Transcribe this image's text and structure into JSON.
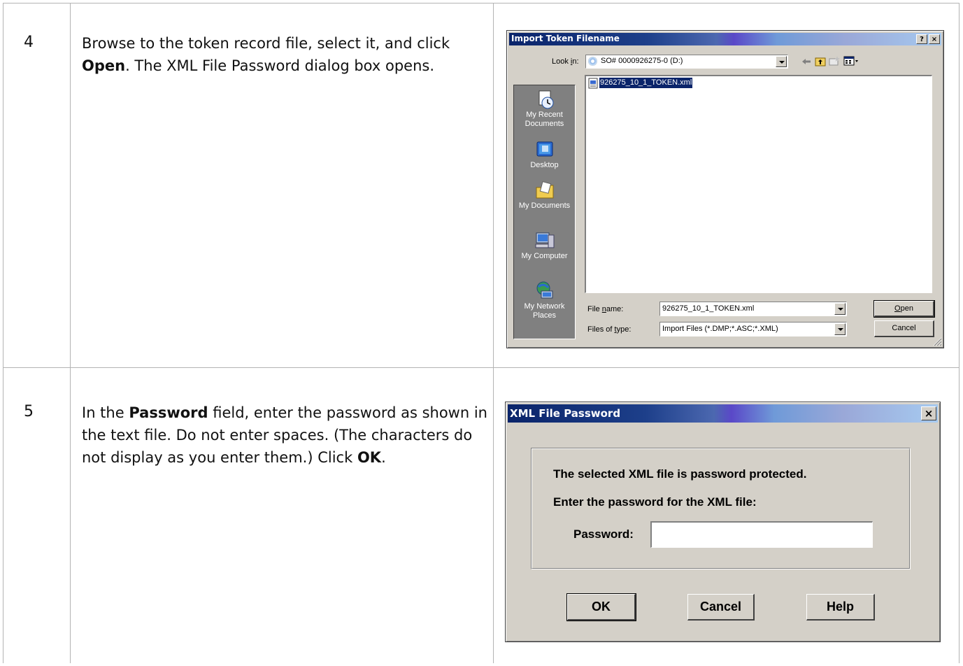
{
  "steps": [
    {
      "number": "4",
      "text_parts": [
        "Browse to the token record file, select it, and click ",
        "Open",
        ". The XML File Password dialog box opens."
      ]
    },
    {
      "number": "5",
      "text_parts": [
        "In the ",
        "Password",
        " field, enter the password as shown in the text file. Do not enter spaces. (The characters do not display as you enter them.) Click ",
        "OK",
        "."
      ]
    }
  ],
  "import_dialog": {
    "title": "Import Token Filename",
    "help_glyph": "?",
    "close_glyph": "×",
    "look_in_label_pre": "Look ",
    "look_in_label_u": "i",
    "look_in_label_post": "n:",
    "look_in_value": "SO# 0000926275-0 (D:)",
    "toolbar_icons": [
      "back-icon",
      "up-folder-icon",
      "new-folder-icon",
      "views-menu-icon"
    ],
    "places": [
      {
        "icon": "recent-documents-icon",
        "label_lines": [
          "My Recent",
          "Documents"
        ]
      },
      {
        "icon": "desktop-icon",
        "label_lines": [
          "Desktop"
        ]
      },
      {
        "icon": "my-documents-icon",
        "label_lines": [
          "My Documents"
        ]
      },
      {
        "icon": "my-computer-icon",
        "label_lines": [
          "My Computer"
        ]
      },
      {
        "icon": "network-places-icon",
        "label_lines": [
          "My Network",
          "Places"
        ]
      }
    ],
    "files": [
      {
        "name": "926275_10_1_TOKEN.xml",
        "icon": "xml-file-icon",
        "selected": true
      }
    ],
    "file_name_label_pre": "File ",
    "file_name_label_u": "n",
    "file_name_label_post": "ame:",
    "file_name_value": "926275_10_1_TOKEN.xml",
    "file_type_label_pre": "Files of ",
    "file_type_label_u": "t",
    "file_type_label_post": "ype:",
    "file_type_value": "Import Files (*.DMP;*.ASC;*.XML)",
    "open_label_u": "O",
    "open_label_post": "pen",
    "cancel_label": "Cancel"
  },
  "password_dialog": {
    "title": "XML File Password",
    "close_glyph": "×",
    "message_line1": "The selected XML file is password protected.",
    "message_line2": "Enter the password for the XML file:",
    "password_label": "Password:",
    "password_value": "",
    "ok_label": "OK",
    "cancel_label": "Cancel",
    "help_label": "Help"
  },
  "colors": {
    "dialog_face": "#d4d0c8",
    "title_start": "#0a246a",
    "title_end": "#a6caf0",
    "selection": "#0a246a",
    "table_rule": "#b3b3b3"
  }
}
